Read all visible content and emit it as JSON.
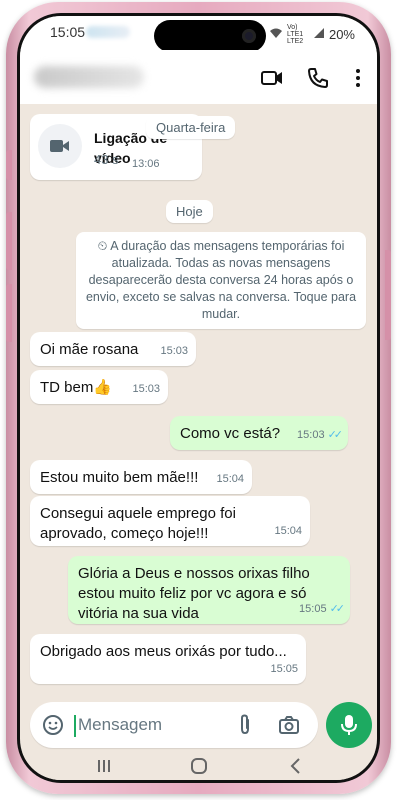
{
  "status": {
    "time": "15:05",
    "signal_text": "Vo) LTE1 LTE2",
    "battery": "20%"
  },
  "header": {
    "icons": [
      "video-call-icon",
      "phone-call-icon",
      "more-options-icon"
    ]
  },
  "call_card": {
    "title": "Ligação de vídeo",
    "duration": "43 s",
    "time": "13:06"
  },
  "dates": {
    "wednesday": "Quarta-feira",
    "today": "Hoje"
  },
  "system_message": "A duração das mensagens temporárias foi atualizada. Todas as novas mensagens desaparecerão desta conversa 24 horas após o envio, exceto se salvas na conversa. Toque para mudar.",
  "messages": [
    {
      "text": "Oi mãe rosana",
      "time": "15:03"
    },
    {
      "text": "TD bem👍",
      "time": "15:03"
    },
    {
      "text": "Como vc está?",
      "time": "15:03"
    },
    {
      "text": "Estou muito bem mãe!!!",
      "time": "15:04"
    },
    {
      "text": "Consegui aquele emprego foi aprovado, começo hoje!!!",
      "time": "15:04"
    },
    {
      "text": "Glória a Deus e nossos orixas filho estou muito feliz por vc agora e só vitória na sua vida",
      "time": "15:05"
    },
    {
      "text": "Obrigado aos meus orixás por tudo...",
      "time": "15:05"
    }
  ],
  "composer": {
    "placeholder": "Mensagem"
  },
  "colors": {
    "accent_green": "#1daa61",
    "outgoing_bubble": "#d9fdd3",
    "chat_bg": "#efe7de",
    "ticks_blue": "#53bdeb"
  }
}
